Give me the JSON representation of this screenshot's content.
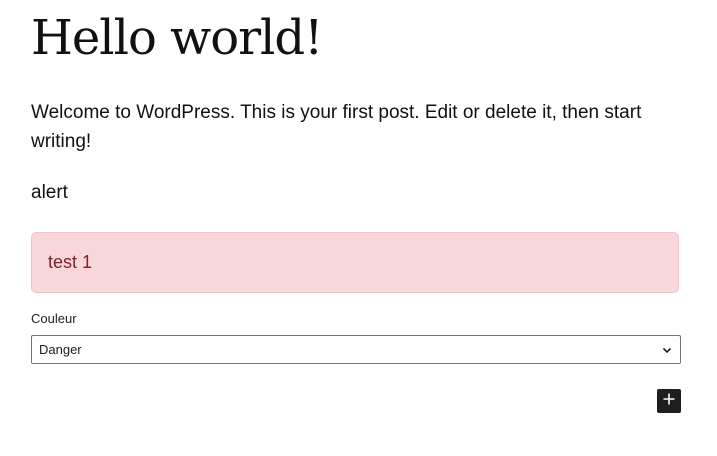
{
  "post": {
    "title": "Hello world!",
    "paragraph": "Welcome to WordPress. This is your first post. Edit or delete it, then start writing!"
  },
  "alert_block": {
    "label": "alert",
    "message": "test 1",
    "colors": {
      "background": "#f8d7da",
      "border": "#f5c2c7",
      "text": "#842029"
    }
  },
  "color_setting": {
    "label": "Couleur",
    "selected": "Danger"
  },
  "toolbar": {
    "add_block_icon": "plus-icon",
    "add_block_color": "#1e1e1e"
  }
}
